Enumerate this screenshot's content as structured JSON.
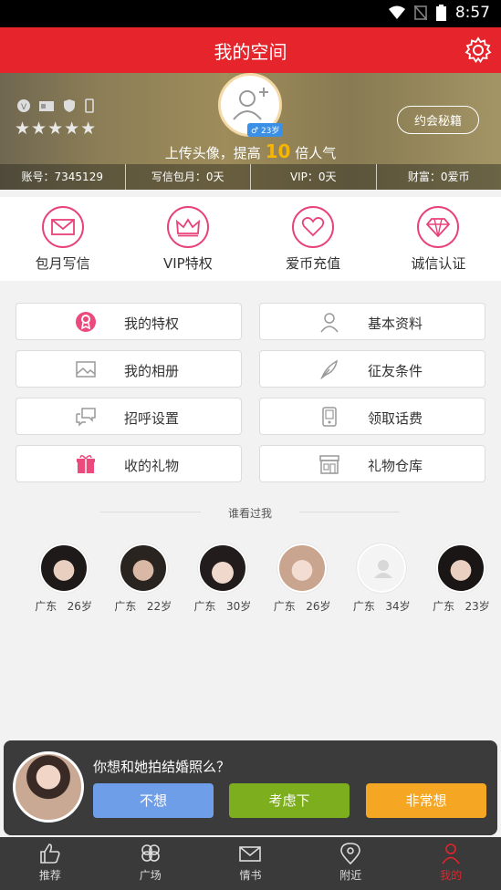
{
  "status": {
    "time": "8:57"
  },
  "header": {
    "title": "我的空间"
  },
  "profile": {
    "stars": "★★★★★",
    "age_badge": "23岁",
    "upload_tip_pre": "上传头像，提高",
    "upload_tip_num": "10",
    "upload_tip_post": "倍人气",
    "secret_button": "约会秘籍",
    "stats": [
      "账号：7345129",
      "写信包月：0天",
      "VIP：0天",
      "财富：0爱币"
    ]
  },
  "quick_actions": [
    {
      "label": "包月写信",
      "icon": "envelope-icon"
    },
    {
      "label": "VIP特权",
      "icon": "crown-icon"
    },
    {
      "label": "爱币充值",
      "icon": "heart-icon"
    },
    {
      "label": "诚信认证",
      "icon": "diamond-icon"
    }
  ],
  "menu": [
    {
      "label": "我的特权",
      "icon": "privilege-icon"
    },
    {
      "label": "基本资料",
      "icon": "person-icon"
    },
    {
      "label": "我的相册",
      "icon": "photo-icon"
    },
    {
      "label": "征友条件",
      "icon": "feather-icon"
    },
    {
      "label": "招呼设置",
      "icon": "chat-icon"
    },
    {
      "label": "领取话费",
      "icon": "phone-icon"
    },
    {
      "label": "收的礼物",
      "icon": "gift-icon"
    },
    {
      "label": "礼物仓库",
      "icon": "store-icon"
    }
  ],
  "visitors_title": "谁看过我",
  "visitors": [
    {
      "region": "广东",
      "age": "26岁"
    },
    {
      "region": "广东",
      "age": "22岁"
    },
    {
      "region": "广东",
      "age": "30岁"
    },
    {
      "region": "广东",
      "age": "26岁"
    },
    {
      "region": "广东",
      "age": "34岁"
    },
    {
      "region": "广东",
      "age": "23岁"
    }
  ],
  "prompt": {
    "question": "你想和她拍结婚照么？",
    "buttons": [
      "不想",
      "考虑下",
      "非常想"
    ]
  },
  "tabs": [
    {
      "label": "推荐",
      "icon": "thumbs-up-icon"
    },
    {
      "label": "广场",
      "icon": "clover-icon"
    },
    {
      "label": "情书",
      "icon": "mail-icon"
    },
    {
      "label": "附近",
      "icon": "location-icon"
    },
    {
      "label": "我的",
      "icon": "user-icon"
    }
  ],
  "colors": {
    "accent": "#e5242b",
    "pink": "#e8427a",
    "tab_bg": "#3a3a3a"
  }
}
